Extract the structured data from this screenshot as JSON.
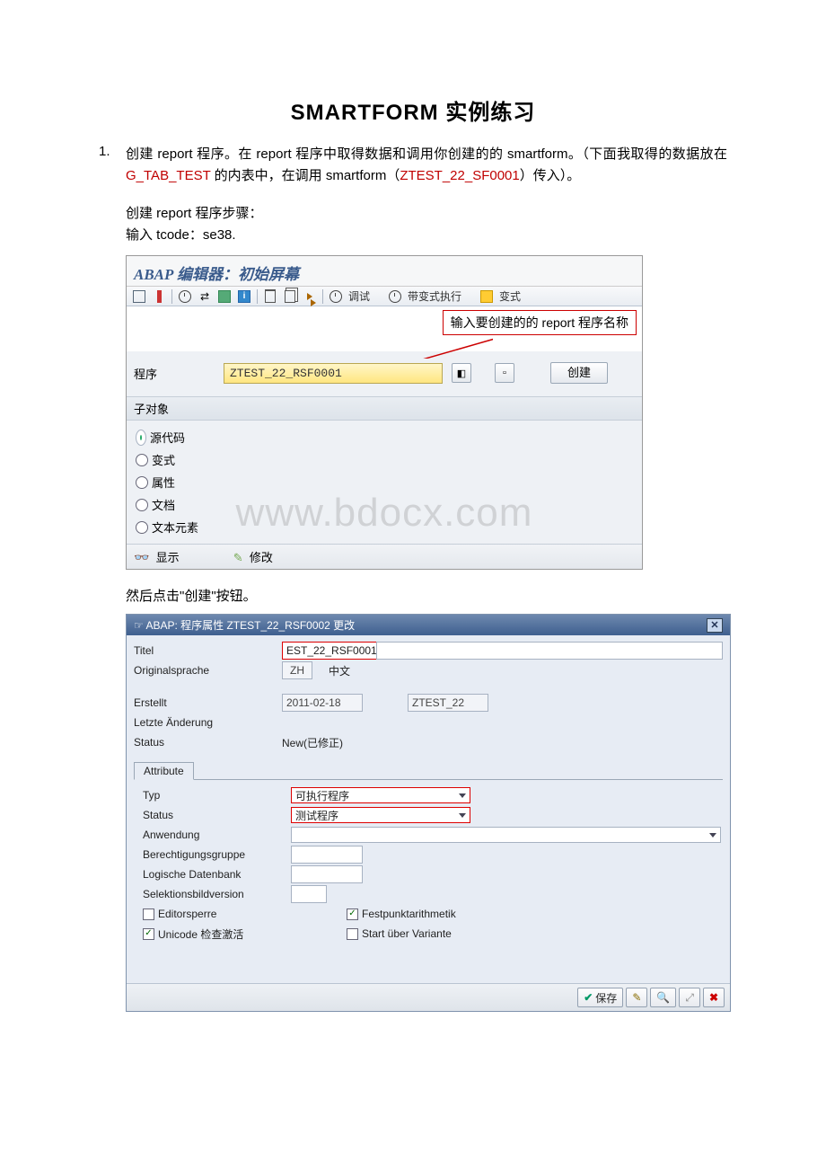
{
  "title": "SMARTFORM 实例练习",
  "list_num": "1.",
  "paragraph": {
    "p1a": "创建 report 程序。在 report 程序中取得数据和调用你创建的的 smartform。（下面我取得的数据放在 ",
    "p1b_red": "G_TAB_TEST",
    "p1c": " 的内表中，在调用 smartform（",
    "p1d_red": "ZTEST_22_SF0001",
    "p1e": "）传入）。"
  },
  "steps": {
    "s1": "创建 report 程序步骤：",
    "s2": "输入 tcode：se38."
  },
  "shot1": {
    "sap_title": "ABAP 编辑器：初始屏幕",
    "toolbar": {
      "debug": "调试",
      "with_var": "带变式执行",
      "variant": "变式"
    },
    "callout": "输入要创建的的 report 程序名称",
    "prog_label": "程序",
    "prog_value": "ZTEST_22_RSF0001",
    "create_btn": "创建",
    "sub_header": "子对象",
    "radios": {
      "r1": "源代码",
      "r2": "变式",
      "r3": "属性",
      "r4": "文档",
      "r5": "文本元素"
    },
    "display": "显示",
    "modify": "修改"
  },
  "watermark": "www.bdocx.com",
  "mid_text": "然后点击\"创建\"按钮。",
  "shot2": {
    "dlg_title": "ABAP: 程序属性 ZTEST_22_RSF0002 更改",
    "labels": {
      "titel": "Titel",
      "orig": "Originalsprache",
      "erst": "Erstellt",
      "letzte": "Letzte Änderung",
      "status": "Status",
      "tab": "Attribute",
      "typ": "Typ",
      "status2": "Status",
      "anw": "Anwendung",
      "berecht": "Berechtigungsgruppe",
      "logdb": "Logische Datenbank",
      "selbild": "Selektionsbildversion",
      "edsperre": "Editorsperre",
      "unicode": "Unicode 检查激活",
      "festpunkt": "Festpunktarithmetik",
      "startvar": "Start über Variante"
    },
    "values": {
      "titel": "EST_22_RSF0001",
      "lang_code": "ZH",
      "lang_name": "中文",
      "erst_date": "2011-02-18",
      "erst_user": "ZTEST_22",
      "status": "New(已修正)",
      "typ": "可执行程序",
      "status2": "测试程序"
    },
    "footer": {
      "save": "保存"
    }
  }
}
